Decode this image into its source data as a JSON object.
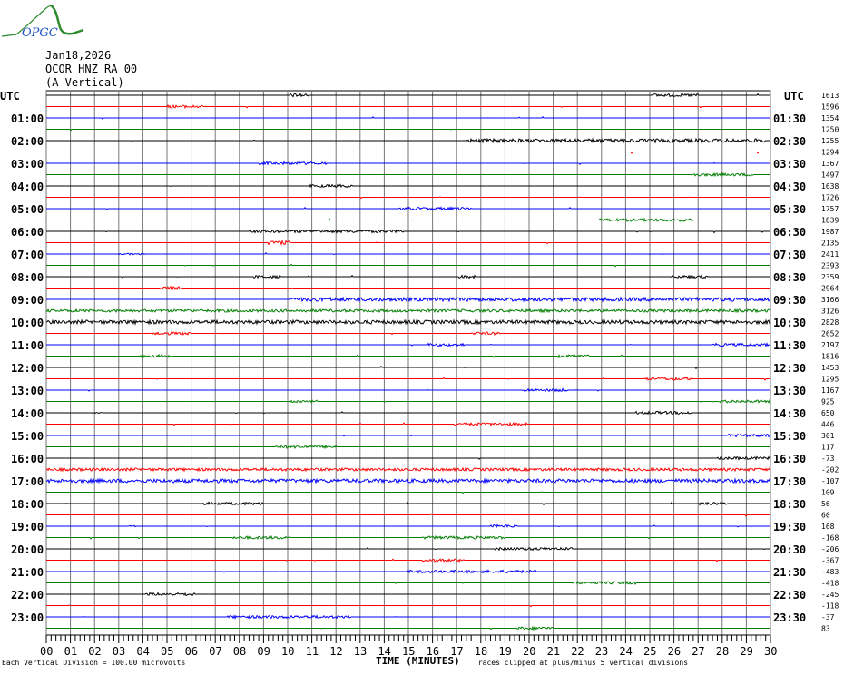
{
  "logo_text": "OPGC",
  "header": {
    "date": "Jan18,2026",
    "station": "OCOR HNZ RA 00",
    "component": "(A Vertical)"
  },
  "chart_data": {
    "type": "line",
    "title": "OCOR HNZ RA 00 helicorder",
    "xlabel": "TIME (MINUTES)",
    "xlim": [
      0,
      30
    ],
    "x_ticks": [
      "00",
      "01",
      "02",
      "03",
      "04",
      "05",
      "06",
      "07",
      "08",
      "09",
      "10",
      "11",
      "12",
      "13",
      "14",
      "15",
      "16",
      "17",
      "18",
      "19",
      "20",
      "21",
      "22",
      "23",
      "24",
      "25",
      "26",
      "27",
      "28",
      "29",
      "30"
    ],
    "left_axis_title": "UTC",
    "right_axis_title": "UTC",
    "left_labels": [
      "01:00",
      "02:00",
      "03:00",
      "04:00",
      "05:00",
      "06:00",
      "07:00",
      "08:00",
      "09:00",
      "10:00",
      "11:00",
      "12:00",
      "13:00",
      "14:00",
      "15:00",
      "16:00",
      "17:00",
      "18:00",
      "19:00",
      "20:00",
      "21:00",
      "22:00",
      "23:00"
    ],
    "right_labels": [
      "01:30",
      "02:30",
      "03:30",
      "04:30",
      "05:30",
      "06:30",
      "07:30",
      "08:30",
      "09:30",
      "10:30",
      "11:30",
      "12:30",
      "13:30",
      "14:30",
      "15:30",
      "16:30",
      "17:30",
      "18:30",
      "19:30",
      "20:30",
      "21:30",
      "22:30",
      "23:30"
    ],
    "trace_offsets": [
      "1613",
      "1596",
      "1354",
      "1250",
      "1255",
      "1294",
      "1367",
      "1497",
      "1638",
      "1726",
      "1757",
      "1839",
      "1987",
      "2135",
      "2411",
      "2393",
      "2359",
      "2964",
      "3166",
      "3126",
      "2828",
      "2652",
      "2197",
      "1816",
      "1453",
      "1295",
      "1167",
      "925",
      "650",
      "446",
      "301",
      "117",
      "-73",
      "-202",
      "-107",
      "109",
      "56",
      "60",
      "168",
      "-168",
      "-206",
      "-367",
      "-483",
      "-418",
      "-245",
      "-118",
      "-37",
      "83"
    ],
    "trace_colors": [
      "#000000",
      "#ff0000",
      "#0000ff",
      "#008000"
    ],
    "events": [
      [
        [
          10.1,
          10.9,
          2
        ],
        [
          25.1,
          27.0,
          1.5
        ]
      ],
      [
        [
          5.0,
          6.5,
          1.5
        ]
      ],
      [],
      [],
      [
        [
          17.4,
          29.8,
          2
        ]
      ],
      [],
      [
        [
          8.8,
          11.6,
          1.5
        ]
      ],
      [
        [
          26.7,
          29.3,
          1.5
        ]
      ],
      [
        [
          10.9,
          12.7,
          1.5
        ]
      ],
      [],
      [
        [
          14.6,
          17.6,
          1.5
        ]
      ],
      [
        [
          22.9,
          26.8,
          1.5
        ]
      ],
      [
        [
          8.4,
          14.8,
          1.5
        ]
      ],
      [
        [
          9.2,
          10.1,
          2
        ]
      ],
      [
        [
          3.0,
          4.1,
          0.8
        ]
      ],
      [],
      [
        [
          8.6,
          9.7,
          1.5
        ],
        [
          17.1,
          17.8,
          1.5
        ],
        [
          25.9,
          27.4,
          1.5
        ]
      ],
      [
        [
          4.7,
          5.6,
          2
        ]
      ],
      [
        [
          10.1,
          30,
          2
        ]
      ],
      [
        [
          0,
          30,
          1.5
        ]
      ],
      [
        [
          0,
          30,
          2
        ]
      ],
      [
        [
          4.3,
          6.0,
          1.5
        ],
        [
          17.6,
          18.8,
          1.5
        ]
      ],
      [
        [
          15.8,
          17.3,
          1.5
        ],
        [
          27.6,
          30,
          1.5
        ]
      ],
      [
        [
          3.9,
          5.2,
          1.5
        ],
        [
          21.2,
          22.5,
          1.5
        ]
      ],
      [],
      [
        [
          24.8,
          26.7,
          1.5
        ]
      ],
      [
        [
          19.7,
          21.6,
          1.5
        ]
      ],
      [
        [
          10.1,
          11.2,
          1.5
        ],
        [
          27.8,
          30,
          1.5
        ]
      ],
      [
        [
          1.9,
          2.4,
          0.8
        ],
        [
          24.4,
          26.7,
          1.5
        ]
      ],
      [
        [
          16.9,
          19.9,
          1.5
        ]
      ],
      [
        [
          28.2,
          30,
          1.5
        ]
      ],
      [
        [
          9.5,
          12.0,
          1.5
        ]
      ],
      [
        [
          27.8,
          30,
          1.5
        ]
      ],
      [
        [
          0,
          30,
          1.5
        ]
      ],
      [
        [
          0,
          30,
          2
        ]
      ],
      [],
      [
        [
          6.5,
          9.0,
          1.5
        ],
        [
          27.0,
          28.2,
          1.5
        ]
      ],
      [],
      [
        [
          18.4,
          19.5,
          1.5
        ],
        [
          3.4,
          3.7,
          0.8
        ]
      ],
      [
        [
          7.7,
          10.1,
          1.5
        ],
        [
          15.6,
          19.0,
          1.5
        ]
      ],
      [
        [
          18.6,
          21.8,
          1.5
        ]
      ],
      [
        [
          15.6,
          17.3,
          1.5
        ]
      ],
      [
        [
          15.0,
          20.3,
          1.5
        ]
      ],
      [
        [
          21.8,
          24.4,
          1.5
        ]
      ],
      [
        [
          4.1,
          6.2,
          1.5
        ]
      ],
      [],
      [
        [
          7.5,
          12.6,
          1.5
        ]
      ],
      [
        [
          19.5,
          21.0,
          1.5
        ]
      ]
    ],
    "footer_left": "Each Vertical Division =  100.00 microvolts",
    "footer_right": "Traces clipped at plus/minus 5 vertical divisions"
  }
}
